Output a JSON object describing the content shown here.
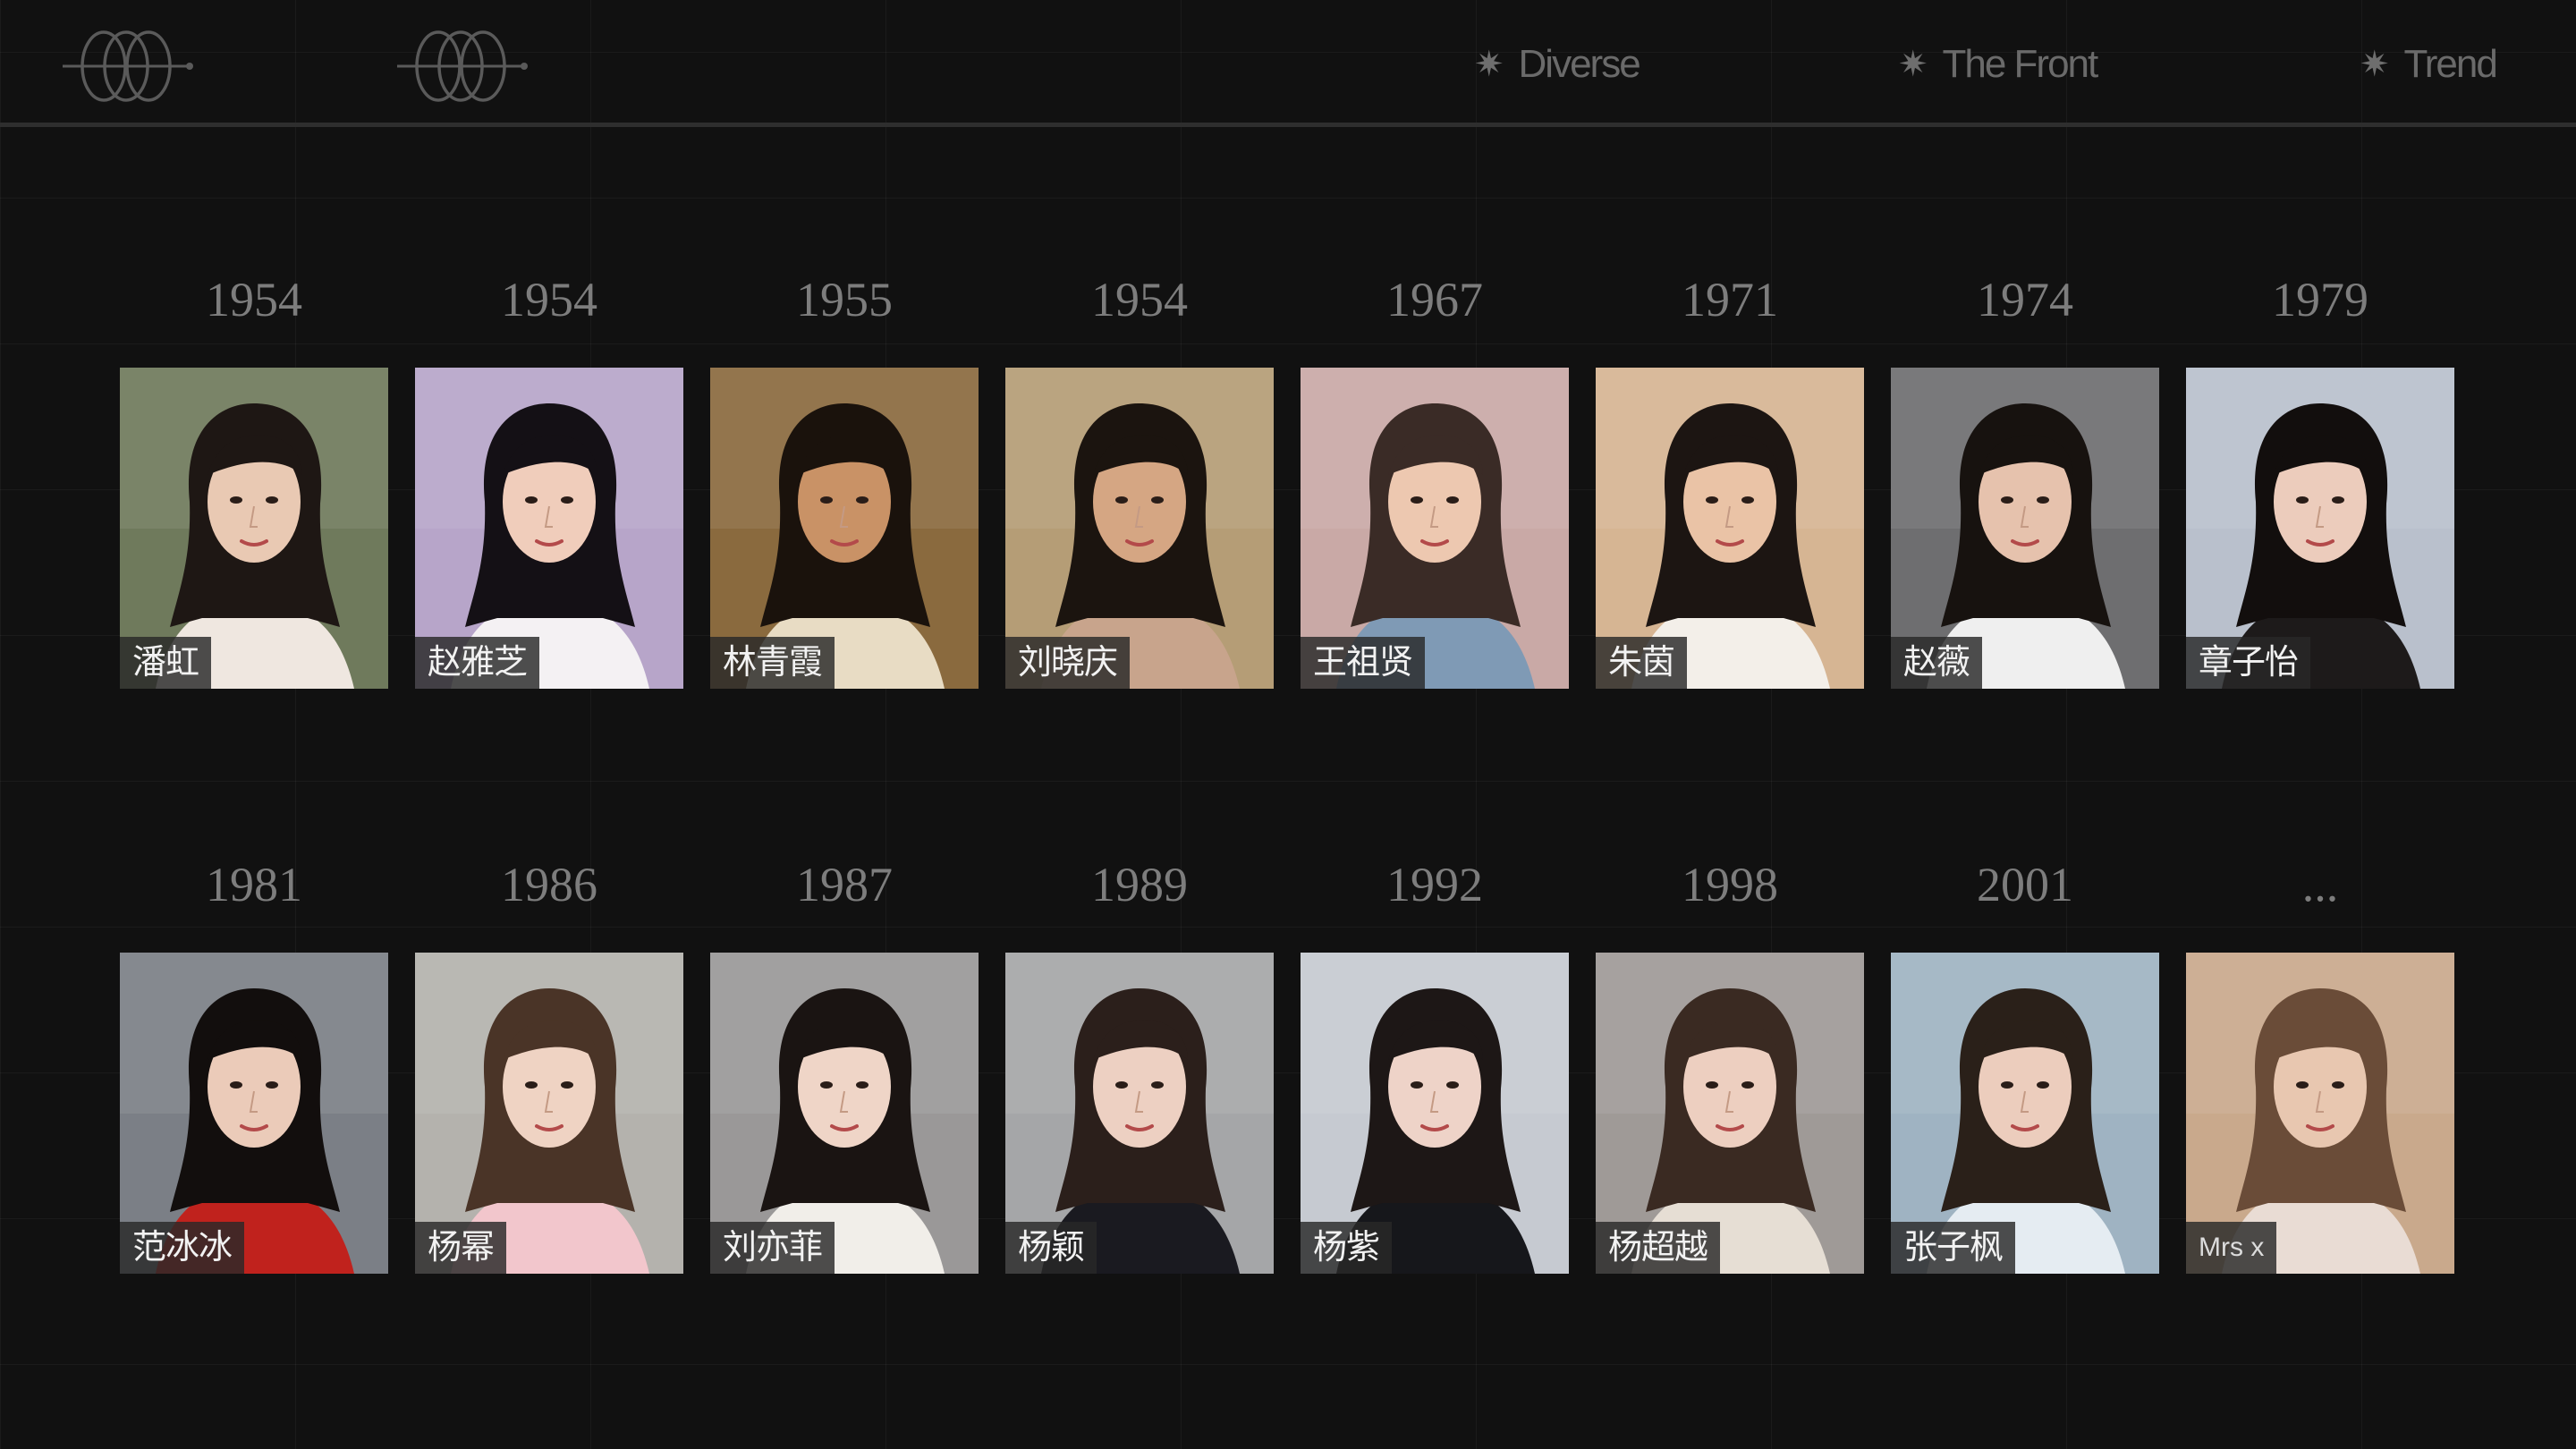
{
  "header": {
    "nav": [
      {
        "label": "Diverse"
      },
      {
        "label": "The Front"
      },
      {
        "label": "Trend"
      }
    ]
  },
  "rows": [
    [
      {
        "year": "1954",
        "name": "潘虹",
        "bg": "#6f7a5c",
        "skin": "#e9c9b3",
        "hair": "#1e1714",
        "cloth": "#efe7e0"
      },
      {
        "year": "1954",
        "name": "赵雅芝",
        "bg": "#b7a5c9",
        "skin": "#f0cdbb",
        "hair": "#141015",
        "cloth": "#f4f1f3"
      },
      {
        "year": "1955",
        "name": "林青霞",
        "bg": "#8a6a3e",
        "skin": "#c99266",
        "hair": "#1a120c",
        "cloth": "#e8dcc4"
      },
      {
        "year": "1954",
        "name": "刘晓庆",
        "bg": "#b59d76",
        "skin": "#d5a683",
        "hair": "#1b140f",
        "cloth": "#c8a48c"
      },
      {
        "year": "1967",
        "name": "王祖贤",
        "bg": "#c9a9a6",
        "skin": "#edc8b0",
        "hair": "#3a2b26",
        "cloth": "#7f9ab5"
      },
      {
        "year": "1971",
        "name": "朱茵",
        "bg": "#d6b593",
        "skin": "#eac3a6",
        "hair": "#1c1512",
        "cloth": "#f3efe9"
      },
      {
        "year": "1974",
        "name": "赵薇",
        "bg": "#6e6e70",
        "skin": "#e6c2ad",
        "hair": "#17120f",
        "cloth": "#efefef"
      },
      {
        "year": "1979",
        "name": "章子怡",
        "bg": "#b9c0cc",
        "skin": "#ecccbc",
        "hair": "#120e0d",
        "cloth": "#1d1a1a"
      }
    ],
    [
      {
        "year": "1981",
        "name": "范冰冰",
        "bg": "#7b7f86",
        "skin": "#ebcbb9",
        "hair": "#120e0d",
        "cloth": "#c0221d"
      },
      {
        "year": "1986",
        "name": "杨幂",
        "bg": "#b4b2ad",
        "skin": "#efd3c3",
        "hair": "#4a3427",
        "cloth": "#f2c6cc"
      },
      {
        "year": "1987",
        "name": "刘亦菲",
        "bg": "#9a9898",
        "skin": "#efd5c7",
        "hair": "#1a1412",
        "cloth": "#f1eee9"
      },
      {
        "year": "1989",
        "name": "杨颖",
        "bg": "#a5a6a8",
        "skin": "#edd0c2",
        "hair": "#2b1f1b",
        "cloth": "#1a1a20"
      },
      {
        "year": "1992",
        "name": "杨紫",
        "bg": "#c6cad1",
        "skin": "#eed3c8",
        "hair": "#1d1716",
        "cloth": "#16171b"
      },
      {
        "year": "1998",
        "name": "杨超越",
        "bg": "#9f9a97",
        "skin": "#edcfc0",
        "hair": "#3a2a22",
        "cloth": "#e6ded4"
      },
      {
        "year": "2001",
        "name": "张子枫",
        "bg": "#9fb3c2",
        "skin": "#eccdbd",
        "hair": "#2a2019",
        "cloth": "#e5ecf2"
      },
      {
        "year": "...",
        "name": "Mrs x",
        "bg": "#c9a98c",
        "skin": "#e8c7b0",
        "hair": "#6a4c38",
        "cloth": "#e9dcd4",
        "latin": true
      }
    ]
  ]
}
